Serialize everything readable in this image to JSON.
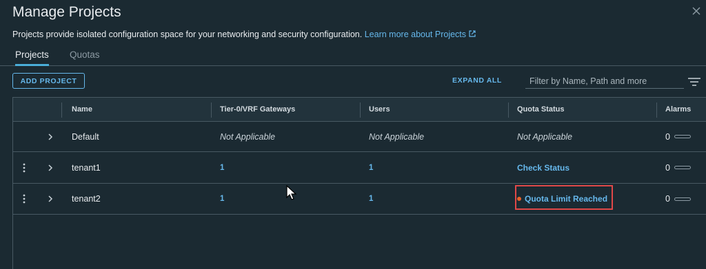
{
  "dialog": {
    "title": "Manage Projects",
    "description": "Projects provide isolated configuration space for your networking and security configuration.",
    "learn_more": "Learn more about Projects"
  },
  "tabs": [
    {
      "label": "Projects",
      "active": true
    },
    {
      "label": "Quotas",
      "active": false
    }
  ],
  "toolbar": {
    "add_label": "ADD PROJECT",
    "expand_label": "EXPAND ALL",
    "filter_placeholder": "Filter by Name, Path and more"
  },
  "table": {
    "columns": [
      "Name",
      "Tier-0/VRF Gateways",
      "Users",
      "Quota Status",
      "Alarms"
    ],
    "rows": [
      {
        "name": "Default",
        "gateways": "Not Applicable",
        "users": "Not Applicable",
        "quota": "Not Applicable",
        "alarms": "0"
      },
      {
        "name": "tenant1",
        "gateways": "1",
        "users": "1",
        "quota": "Check Status",
        "alarms": "0"
      },
      {
        "name": "tenant2",
        "gateways": "1",
        "users": "1",
        "quota": "Quota Limit Reached",
        "alarms": "0"
      }
    ]
  },
  "colors": {
    "background": "#1b2a32",
    "accent": "#66b8ec",
    "alert": "#e5622a",
    "highlight_box": "#e04848"
  },
  "icons": {
    "close": "close-icon",
    "external": "external-link-icon",
    "filter": "filter-lines-icon",
    "kebab": "vertical-ellipsis-icon",
    "chevron": "chevron-right-icon"
  }
}
